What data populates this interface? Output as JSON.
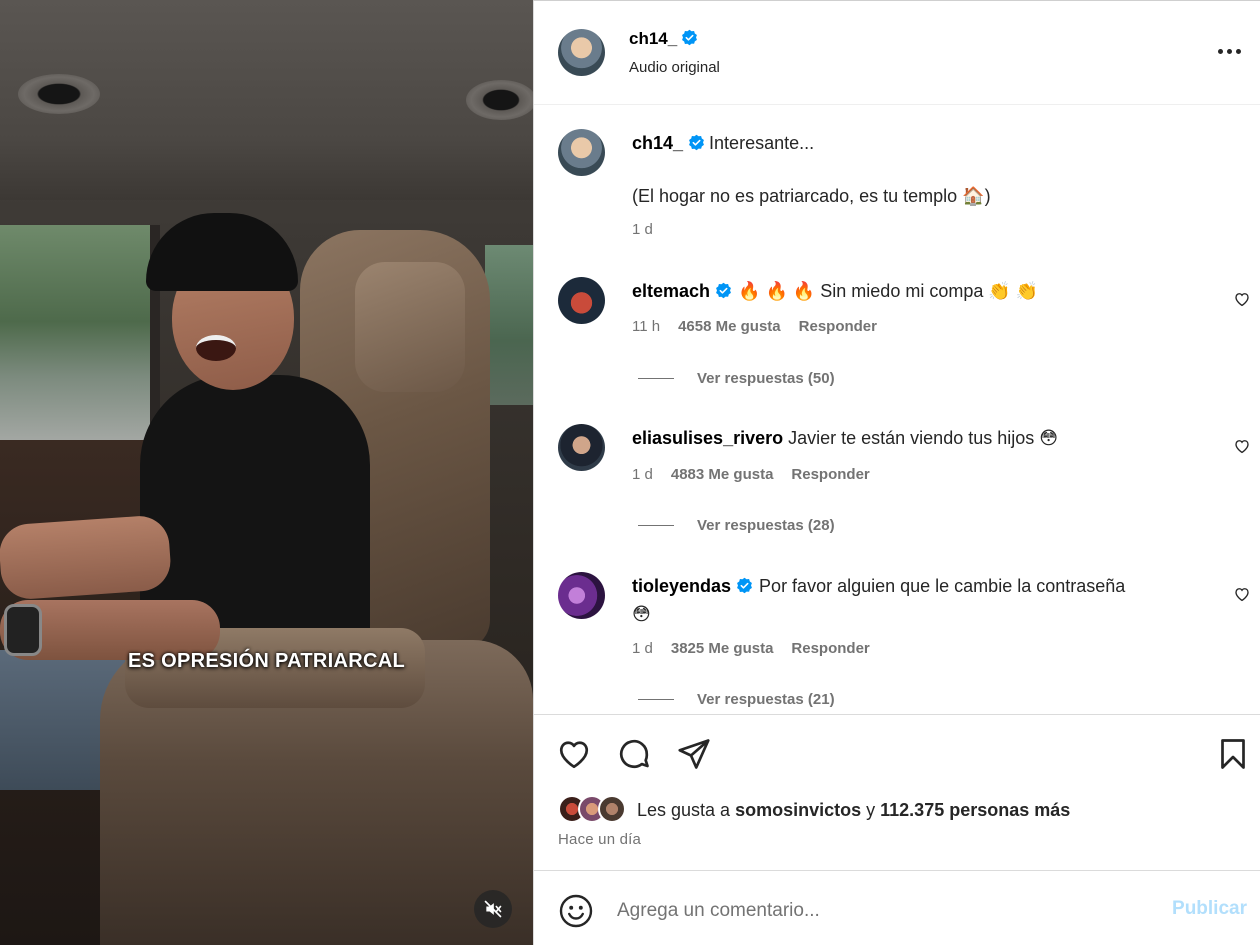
{
  "video": {
    "caption": "ES OPRESIÓN PATRIARCAL",
    "mute_icon": "speaker-muted-icon"
  },
  "post": {
    "author": "ch14_",
    "subtitle": "Audio original",
    "verified": true
  },
  "caption": {
    "author": "ch14_",
    "line1": "Interesante...",
    "line2": "(El hogar no es patriarcado, es tu templo 🏠)",
    "age": "1 d"
  },
  "comments": [
    {
      "user": "eltemach",
      "verified": true,
      "text": "🔥 🔥 🔥 Sin miedo mi compa 👏 👏",
      "age": "11 h",
      "likes": "4658 Me gusta",
      "reply": "Responder",
      "view_replies": "Ver respuestas (50)"
    },
    {
      "user": "eliasulises_rivero",
      "verified": false,
      "text": "Javier te están viendo tus hijos 😳",
      "age": "1 d",
      "likes": "4883 Me gusta",
      "reply": "Responder",
      "view_replies": "Ver respuestas (28)"
    },
    {
      "user": "tioleyendas",
      "verified": true,
      "text": "Por favor alguien que le cambie la contraseña",
      "text_line2": "😳",
      "age": "1 d",
      "likes": "3825 Me gusta",
      "reply": "Responder",
      "view_replies": "Ver respuestas (21)"
    }
  ],
  "likes": {
    "prefix": "Les gusta a ",
    "user": "somosinvictos",
    "connector": " y ",
    "others": "112.375 personas más"
  },
  "timestamp": "Hace un día",
  "composer": {
    "placeholder": "Agrega un comentario...",
    "publish_label": "Publicar"
  },
  "colors": {
    "verified": "#0095f6",
    "secondary_text": "#737373",
    "publish_disabled": "#b2dffc"
  }
}
